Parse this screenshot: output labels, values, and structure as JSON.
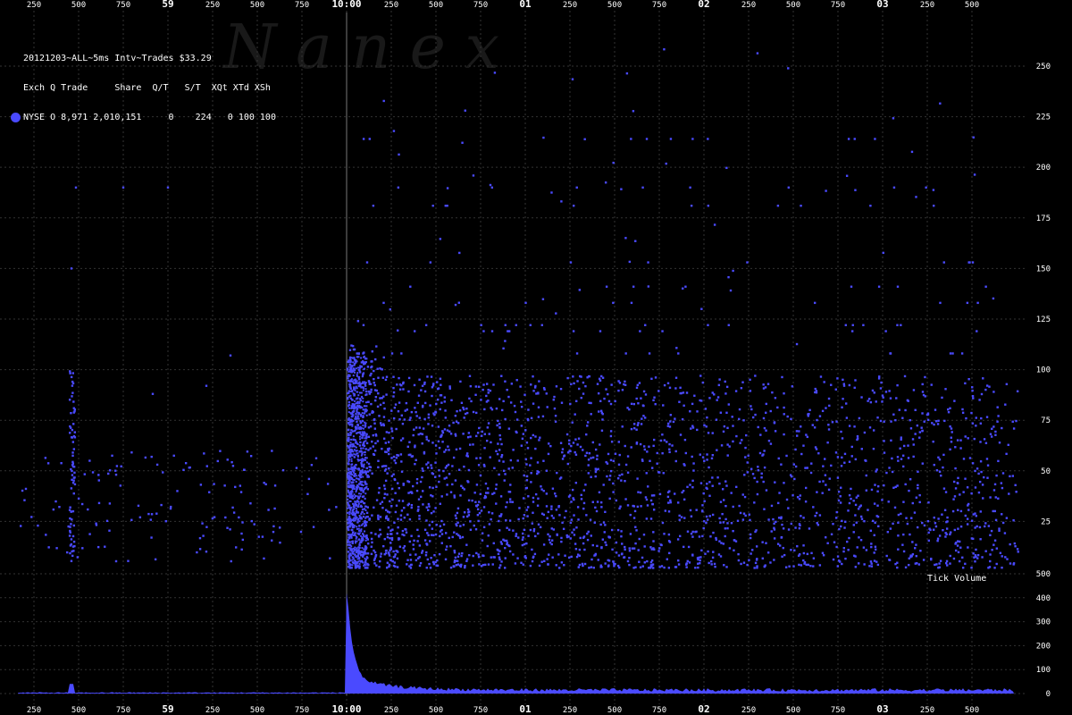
{
  "legend": {
    "title": "20121203~ALL~5ms Intv~Trades $33.29",
    "header": "Exch Q Trade     Share  Q/T   S/T  XQt XTd XSh",
    "row": "NYSE O 8,971 2,010,151     0    224   0 100 100",
    "series_color": "#4a4aff"
  },
  "watermark": "N a n e x",
  "tick_volume_label": "Tick Volume",
  "chart_data": {
    "type": "scatter",
    "title": "20121203~ALL~5ms Intv~Trades $33.29",
    "x_tick_labels": [
      "250",
      "500",
      "750",
      "59",
      "250",
      "500",
      "750",
      "10:00",
      "250",
      "500",
      "750",
      "01",
      "250",
      "500",
      "750",
      "02",
      "250",
      "500",
      "750",
      "03",
      "250",
      "500"
    ],
    "bold_x_labels": [
      "59",
      "10:00",
      "01",
      "02",
      "03"
    ],
    "upper_panel": {
      "y_ticks": [
        25,
        50,
        75,
        100,
        125,
        150,
        175,
        200,
        225,
        250
      ],
      "ylim": [
        0,
        265
      ],
      "series": [
        {
          "name": "NYSE",
          "description_of_values": "trade scatter, dense band 0-100 after 10:00, sparse outliers up to ~265"
        }
      ],
      "horizontal_bands": [
        214,
        190,
        181,
        153,
        141,
        133,
        122,
        119,
        108
      ]
    },
    "lower_panel": {
      "label": "Tick Volume",
      "y_ticks": [
        0,
        100,
        200,
        300,
        400,
        500
      ],
      "ylim": [
        0,
        500
      ],
      "spikes": [
        {
          "x_label": "500",
          "value": 40
        },
        {
          "x_label": "10:00",
          "value": 420
        }
      ]
    },
    "grid": true
  }
}
